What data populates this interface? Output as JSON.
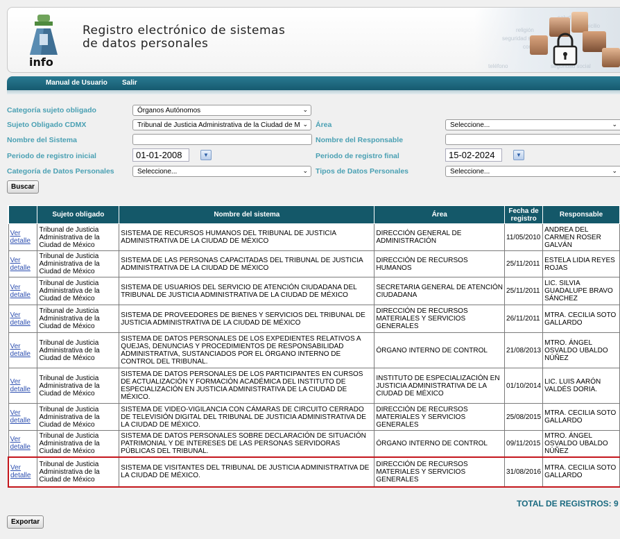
{
  "header": {
    "logo_text": "info",
    "title_line1": "Registro electrónico de sistemas",
    "title_line2": "de datos personales",
    "art_words": [
      "religión",
      "seguridad social",
      "salud",
      "domicilio",
      "correo",
      "teléfono",
      "seguridad social"
    ]
  },
  "nav": {
    "manual_label": "Manual de Usuario",
    "exit_label": "Salir"
  },
  "filters": {
    "categoria_label": "Categoría sujeto obligado",
    "categoria_value": "Órganos Autónomos",
    "sujeto_label": "Sujeto Obligado CDMX",
    "sujeto_value": "Tribunal de Justicia Administrativa de la Ciudad de M",
    "area_label": "Área",
    "area_value": "Seleccione...",
    "nombre_sistema_label": "Nombre del Sistema",
    "nombre_sistema_value": "",
    "nombre_responsable_label": "Nombre del Responsable",
    "nombre_responsable_value": "",
    "periodo_inicial_label": "Periodo de registro inicial",
    "periodo_inicial_value": "01-01-2008",
    "periodo_final_label": "Periodo de registro final",
    "periodo_final_value": "15-02-2024",
    "categoria_datos_label": "Categoría de Datos Personales",
    "categoria_datos_value": "Seleccione...",
    "tipos_datos_label": "Tipos de Datos Personales",
    "tipos_datos_value": "Seleccione...",
    "search_label": "Buscar"
  },
  "table": {
    "headers": [
      "",
      "Sujeto obligado",
      "Nombre del sistema",
      "Área",
      "Fecha de registro",
      "Responsable"
    ],
    "rows": [
      {
        "link": "Ver detalle",
        "sujeto": "Tribunal de Justicia Administrativa de la Ciudad de México",
        "sistema": "SISTEMA DE RECURSOS HUMANOS DEL TRIBUNAL DE JUSTICIA ADMINISTRATIVA DE LA CIUDAD DE MÉXICO",
        "area": "DIRECCIÓN GENERAL DE ADMINISTRACIÓN",
        "fecha": "11/05/2010",
        "responsable": "ANDREA DEL CARMEN ROSER GALVÁN"
      },
      {
        "link": "Ver detalle",
        "sujeto": "Tribunal de Justicia Administrativa de la Ciudad de México",
        "sistema": "SISTEMA DE LAS PERSONAS CAPACITADAS DEL TRIBUNAL DE JUSTICIA ADMINISTRATIVA DE LA CIUDAD DE MÉXICO",
        "area": "DIRECCIÓN DE RECURSOS HUMANOS",
        "fecha": "25/11/2011",
        "responsable": "ESTELA LIDIA REYES ROJAS"
      },
      {
        "link": "Ver detalle",
        "sujeto": "Tribunal de Justicia Administrativa de la Ciudad de México",
        "sistema": "SISTEMA DE USUARIOS DEL SERVICIO DE ATENCIÓN CIUDADANA DEL TRIBUNAL DE JUSTICIA ADMINISTRATIVA DE LA CIUDAD DE MÉXICO",
        "area": "SECRETARIA GENERAL DE ATENCIÓN CIUDADANA",
        "fecha": "25/11/2011",
        "responsable": "LIC. SILVIA GUADALUPE BRAVO SÁNCHEZ"
      },
      {
        "link": "Ver detalle",
        "sujeto": "Tribunal de Justicia Administrativa de la Ciudad de México",
        "sistema": "SISTEMA DE PROVEEDORES DE BIENES Y SERVICIOS DEL TRIBUNAL DE JUSTICIA ADMINISTRATIVA DE LA CIUDAD DE MÉXICO",
        "area": "DIRECCIÓN DE RECURSOS MATERIALES Y SERVICIOS GENERALES",
        "fecha": "26/11/2011",
        "responsable": "MTRA. CECILIA SOTO GALLARDO"
      },
      {
        "link": "Ver detalle",
        "sujeto": "Tribunal de Justicia Administrativa de la Ciudad de México",
        "sistema": "SISTEMA DE DATOS PERSONALES DE LOS EXPEDIENTES RELATIVOS A QUEJAS, DENUNCIAS Y PROCEDIMIENTOS DE RESPONSABILIDAD ADMINISTRATIVA, SUSTANCIADOS POR EL ÓRGANO INTERNO DE CONTROL DEL TRIBUNAL.",
        "area": "ÓRGANO INTERNO DE CONTROL",
        "fecha": "21/08/2013",
        "responsable": "MTRO. ÁNGEL OSVALDO UBALDO NÚÑEZ"
      },
      {
        "link": "Ver detalle",
        "sujeto": "Tribunal de Justicia Administrativa de la Ciudad de México",
        "sistema": "SISTEMA DE DATOS PERSONALES DE LOS PARTICIPANTES EN CURSOS DE ACTUALIZACIÓN Y FORMACIÓN ACADÉMICA DEL INSTITUTO DE ESPECIALIZACIÓN EN JUSTICIA ADMINISTRATIVA DE LA CIUDAD DE MÉXICO.",
        "area": "INSTITUTO DE ESPECIALIZACIÓN EN JUSTICIA ADMINISTRATIVA DE LA CIUDAD DE MÉXICO",
        "fecha": "01/10/2014",
        "responsable": "LIC. LUIS AARÓN VALDÉS DORIA."
      },
      {
        "link": "Ver detalle",
        "sujeto": "Tribunal de Justicia Administrativa de la Ciudad de México",
        "sistema": "SISTEMA DE VIDEO-VIGILANCIA CON CÁMARAS DE CIRCUITO CERRADO DE TELEVISIÓN DIGITAL DEL TRIBUNAL DE JUSTICIA ADMINISTRATIVA DE LA CIUDAD DE MÉXICO.",
        "area": "DIRECCIÓN DE RECURSOS MATERIALES Y SERVICIOS GENERALES",
        "fecha": "25/08/2015",
        "responsable": "MTRA. CECILIA SOTO GALLARDO"
      },
      {
        "link": "Ver detalle",
        "sujeto": "Tribunal de Justicia Administrativa de la Ciudad de México",
        "sistema": "SISTEMA DE DATOS PERSONALES SOBRE DECLARACIÓN DE SITUACIÓN PATRIMONIAL Y DE INTERESES DE LAS PERSONAS SERVIDORAS PÚBLICAS DEL TRIBUNAL.",
        "area": "ÓRGANO INTERNO DE CONTROL",
        "fecha": "09/11/2015",
        "responsable": "MTRO. ÁNGEL OSVALDO UBALDO NÚÑEZ"
      },
      {
        "link": "Ver detalle",
        "sujeto": "Tribunal de Justicia Administrativa de la Ciudad de México",
        "sistema": "SISTEMA DE VISITANTES DEL TRIBUNAL DE JUSTICIA ADMINISTRATIVA DE LA CIUDAD DE MÉXICO.",
        "area": "DIRECCIÓN DE RECURSOS MATERIALES Y SERVICIOS GENERALES",
        "fecha": "31/08/2016",
        "responsable": "MTRA. CECILIA SOTO GALLARDO"
      }
    ]
  },
  "total_label": "TOTAL DE REGISTROS: 9",
  "export_label": "Exportar",
  "colors": {
    "nav_bg": "#165a6f",
    "label_teal": "#4aa0b3",
    "table_header": "#145869",
    "highlight": "#c4161c",
    "link": "#2d4fb0"
  }
}
